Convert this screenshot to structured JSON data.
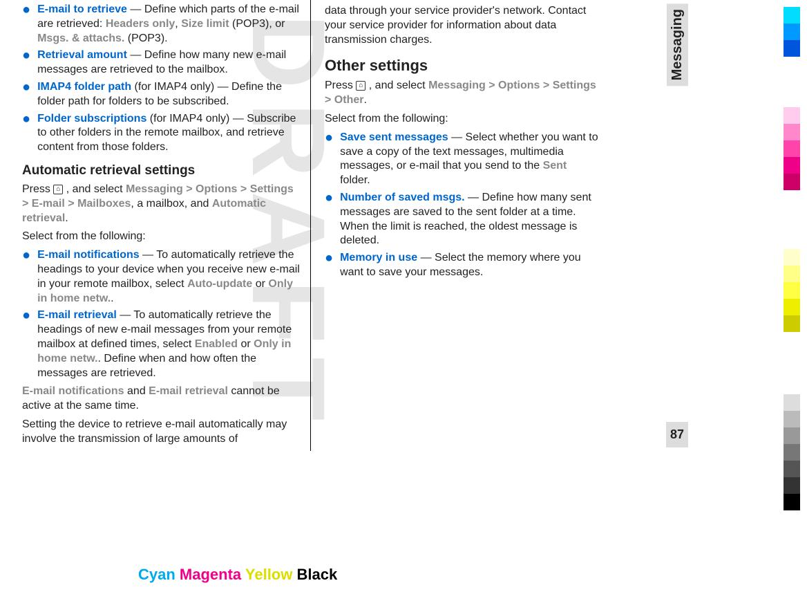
{
  "watermark": "DRAFT",
  "sidebar": {
    "label": "Messaging",
    "pageNumber": "87"
  },
  "column1": {
    "bullets1": [
      {
        "keyword": "E-mail to retrieve",
        "text1": "  — Define which parts of the e-mail are retrieved: ",
        "option1": "Headers only",
        "sep1": ", ",
        "option2": "Size limit",
        "text2": " (POP3), or ",
        "option3": "Msgs. & attachs.",
        "text3": " (POP3)."
      },
      {
        "keyword": "Retrieval amount",
        "text1": "  — Define how many new e-mail messages are retrieved to the mailbox."
      },
      {
        "keyword": "IMAP4 folder path",
        "text1": " (for IMAP4 only)  — Define the folder path for folders to be subscribed."
      },
      {
        "keyword": "Folder subscriptions",
        "text1": " (for IMAP4 only)  — Subscribe to other folders in the remote mailbox, and retrieve content from those folders."
      }
    ],
    "heading1": "Automatic retrieval settings",
    "navText1a": "Press ",
    "navText1b": " , and select ",
    "nav1_1": "Messaging",
    "nav1_2": "Options",
    "nav1_3": "Settings",
    "nav1_4": "E-mail",
    "nav1_5": "Mailboxes",
    "navText1c": ", a mailbox, and ",
    "nav1_6": "Automatic retrieval",
    "navText1d": ".",
    "selectText": "Select from the following:",
    "bullets2": [
      {
        "keyword": "E-mail notifications",
        "text1": "  — To automatically retrieve the headings to your device when you receive new e-mail in your remote mailbox, select ",
        "option1": "Auto-update",
        "sep1": " or ",
        "option2": "Only in home netw.",
        "text2": "."
      },
      {
        "keyword": "E-mail retrieval",
        "text1": "  — To automatically retrieve the headings of new e-mail messages from your remote mailbox at defined times, select ",
        "option1": "Enabled",
        "sep1": " or ",
        "option2": "Only in home netw.",
        "text2": ". Define when and how often the messages are retrieved."
      }
    ],
    "note1_kw1": "E-mail notifications",
    "note1_mid": " and ",
    "note1_kw2": "E-mail retrieval",
    "note1_end": " cannot be active at the same time.",
    "note2": "Setting the device to retrieve e-mail automatically may involve the transmission of large amounts of"
  },
  "column2": {
    "continuation": "data through your service provider's network. Contact your service provider for information about data transmission charges.",
    "heading1": "Other settings",
    "navText1a": "Press ",
    "navText1b": " , and select ",
    "nav1_1": "Messaging",
    "nav1_2": "Options",
    "nav1_3": "Settings",
    "nav1_4": "Other",
    "navText1c": ".",
    "selectText": "Select from the following:",
    "bullets1": [
      {
        "keyword": "Save sent messages",
        "text1": "  — Select whether you want to save a copy of the text messages, multimedia messages, or e-mail that you send to the ",
        "option1": "Sent",
        "text2": " folder."
      },
      {
        "keyword": "Number of saved msgs.",
        "text1": "  — Define how many sent messages are saved to the sent folder at a time. When the limit is reached, the oldest message is deleted."
      },
      {
        "keyword": "Memory in use",
        "text1": "  — Select the memory where you want to save your messages."
      }
    ]
  },
  "footer": {
    "cyan": "Cyan",
    "magenta": "Magenta",
    "yellow": "Yellow",
    "black": "Black"
  },
  "colorBars": {
    "set1": [
      "#00ddff",
      "#0099ff",
      "#0055dd"
    ],
    "set2": [
      "#ffccee",
      "#ff88cc",
      "#ff44aa",
      "#ee0088",
      "#cc0066"
    ],
    "set3": [
      "#ffffcc",
      "#ffff88",
      "#ffff44",
      "#eeee00",
      "#cccc00"
    ],
    "set4": [
      "#dddddd",
      "#bbbbbb",
      "#999999",
      "#777777",
      "#555555",
      "#333333",
      "#000000"
    ]
  }
}
